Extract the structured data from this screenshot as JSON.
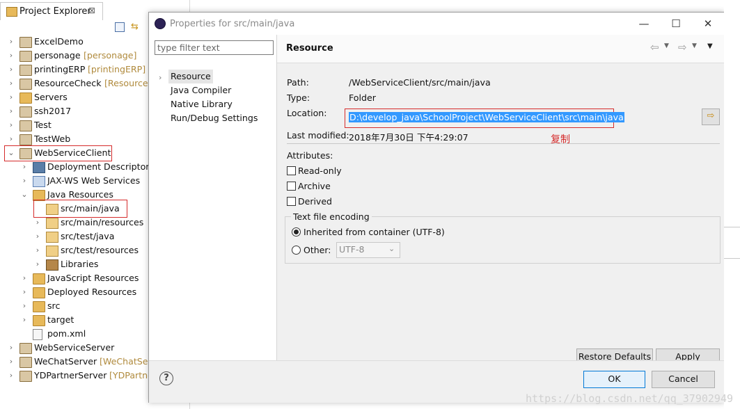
{
  "explorer": {
    "tab_title": "Project Explorer",
    "close_glyph": "⊠",
    "items": [
      {
        "label": "ExcelDemo",
        "decoration": ""
      },
      {
        "label": "personage",
        "decoration": "[personage]"
      },
      {
        "label": "printingERP",
        "decoration": "[printingERP]"
      },
      {
        "label": "ResourceCheck",
        "decoration": "[ResourceCh"
      },
      {
        "label": "Servers",
        "decoration": ""
      },
      {
        "label": "ssh2017",
        "decoration": ""
      },
      {
        "label": "Test",
        "decoration": ""
      },
      {
        "label": "TestWeb",
        "decoration": ""
      },
      {
        "label": "WebServiceClient",
        "decoration": ""
      },
      {
        "label": "Deployment Descriptor: V",
        "decoration": ""
      },
      {
        "label": "JAX-WS Web Services",
        "decoration": ""
      },
      {
        "label": "Java Resources",
        "decoration": ""
      },
      {
        "label": "src/main/java",
        "decoration": ""
      },
      {
        "label": "src/main/resources",
        "decoration": ""
      },
      {
        "label": "src/test/java",
        "decoration": ""
      },
      {
        "label": "src/test/resources",
        "decoration": ""
      },
      {
        "label": "Libraries",
        "decoration": ""
      },
      {
        "label": "JavaScript Resources",
        "decoration": ""
      },
      {
        "label": "Deployed Resources",
        "decoration": ""
      },
      {
        "label": "src",
        "decoration": ""
      },
      {
        "label": "target",
        "decoration": ""
      },
      {
        "label": "pom.xml",
        "decoration": ""
      },
      {
        "label": "WebServiceServer",
        "decoration": ""
      },
      {
        "label": "WeChatServer",
        "decoration": "[WeChatServe"
      },
      {
        "label": "YDPartnerServer",
        "decoration": "[YDPartnerS"
      }
    ]
  },
  "dialog": {
    "title": "Properties for src/main/java",
    "filter_placeholder": "type filter text",
    "nav": [
      "Resource",
      "Java Compiler",
      "Native Library",
      "Run/Debug Settings"
    ],
    "section_title": "Resource",
    "path_label": "Path:",
    "path_value": "/WebServiceClient/src/main/java",
    "type_label": "Type:",
    "type_value": "Folder",
    "location_label": "Location:",
    "location_value": "D:\\develop_java\\SchoolProject\\WebServiceClient\\src\\main\\java",
    "modified_label": "Last modified:",
    "modified_value": "2018年7月30日 下午4:29:07",
    "annotation": "复制",
    "attributes_label": "Attributes:",
    "read_only": "Read-only",
    "archive": "Archive",
    "derived": "Derived",
    "encoding_group": "Text file encoding",
    "inherited": "Inherited from container (UTF-8)",
    "other": "Other:",
    "other_value": "UTF-8",
    "restore_defaults": "Restore Defaults",
    "apply": "Apply",
    "ok": "OK",
    "cancel": "Cancel",
    "help": "?"
  },
  "watermark": "https://blog.csdn.net/qq_37902949",
  "colors": {
    "highlight": "#3399ff",
    "annotation_red": "#d52b2b"
  }
}
